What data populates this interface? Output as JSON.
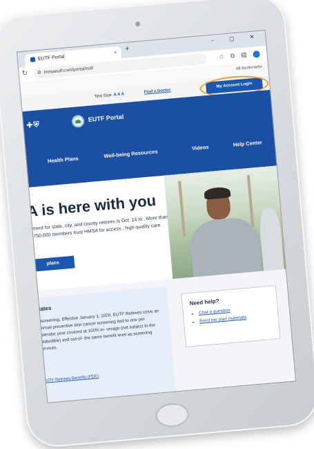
{
  "browser": {
    "tab_title": "EUTF Portal",
    "tab_close": "×",
    "new_tab": "+",
    "window_controls": "– ▢ ✕",
    "url": "hmsaeutf.com/portal/eutf",
    "bookmarks": "All Bookmarks"
  },
  "utility": {
    "text_size_label": "Text Size:",
    "text_size_value": "A A A",
    "find_doctor": "Find a Doctor",
    "account_login": "My Account Login"
  },
  "header": {
    "brand_logo": "BCBS",
    "portal_title": "EUTF Portal",
    "nav": [
      "Health Plans",
      "Well-being Resources",
      "Videos",
      "Help Center"
    ]
  },
  "hero": {
    "title": "A is here with you",
    "body": "ment for state, city, and county retirees is Oct. 14 to . More than 750,000 members trust HMSA for access , high-quality care.",
    "button": "plans"
  },
  "updates": {
    "title": "dates",
    "body": "r screening. Effective January 1, 2026, EUTF Retirees ceive an annual preventive skin cancer screening ited to one per calendar year covered at 100% in- verage (not subject to the deductible) and out-of- the same benefit level as screening services.",
    "link": "EUTF Retirees Benefits (PDF)"
  },
  "help": {
    "title": "Need help?",
    "links": [
      "Chat a question",
      "Send me plan materials"
    ]
  },
  "colors": {
    "brand_blue": "#1a4fa3",
    "button_blue": "#1957b3",
    "highlight_orange": "#f09a2e"
  }
}
